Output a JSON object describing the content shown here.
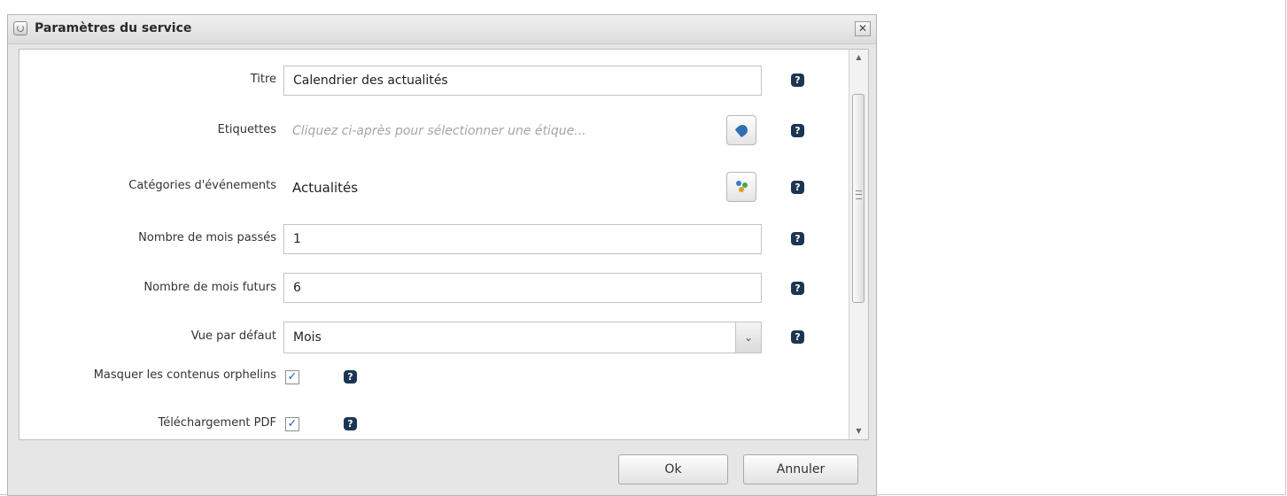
{
  "dialog": {
    "title": "Paramètres du service",
    "close_label": "✕",
    "title_icon": "service-gear-icon"
  },
  "fields": {
    "titre": {
      "label": "Titre",
      "value": "Calendrier des actualités"
    },
    "etiquettes": {
      "label": "Etiquettes",
      "placeholder": "Cliquez ci-après pour sélectionner une étique...",
      "button_icon": "tag-icon"
    },
    "categories": {
      "label": "Catégories d'événements",
      "value": "Actualités",
      "button_icon": "categories-icon"
    },
    "mois_passes": {
      "label": "Nombre de mois passés",
      "value": "1"
    },
    "mois_futurs": {
      "label": "Nombre de mois futurs",
      "value": "6"
    },
    "vue": {
      "label": "Vue par défaut",
      "value": "Mois",
      "arrow": "⌄"
    },
    "masquer": {
      "label": "Masquer les contenus orphelins",
      "checked": true,
      "check_mark": "✓"
    },
    "pdf": {
      "label": "Téléchargement PDF",
      "checked": true,
      "check_mark": "✓"
    }
  },
  "help": {
    "glyph": "?",
    "icon": "help-icon"
  },
  "scrollbar": {
    "up": "▲",
    "down": "▼"
  },
  "footer": {
    "ok_label": "Ok",
    "cancel_label": "Annuler"
  },
  "colors": {
    "help_badge": "#1c3552",
    "check": "#2a5fa8"
  }
}
